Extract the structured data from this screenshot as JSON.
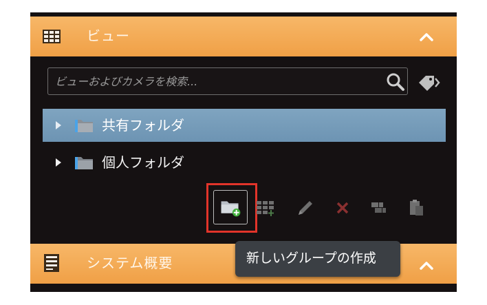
{
  "views": {
    "title": "ビュー",
    "search_placeholder": "ビューおよびカメラを検索...",
    "search_value": "",
    "tree": [
      {
        "label": "共有フォルダ",
        "selected": true
      },
      {
        "label": "個人フォルダ",
        "selected": false
      }
    ],
    "toolbar": [
      {
        "name": "new-group",
        "icon": "folder-plus-icon",
        "enabled": true
      },
      {
        "name": "new-view",
        "icon": "grid-plus-icon",
        "enabled": false
      },
      {
        "name": "rename",
        "icon": "pencil-icon",
        "enabled": false
      },
      {
        "name": "delete",
        "icon": "close-icon",
        "enabled": false
      },
      {
        "name": "copy",
        "icon": "copy-icon",
        "enabled": false
      },
      {
        "name": "paste",
        "icon": "paste-icon",
        "enabled": false
      }
    ]
  },
  "system": {
    "title": "システム概要"
  },
  "tooltip": {
    "text": "新しいグループの作成"
  },
  "colors": {
    "header_orange": "#f0a046",
    "panel_bg": "#151112",
    "selection_blue": "#7fa4c0",
    "highlight_red": "#e2342a",
    "tooltip_bg": "#3b3f44"
  }
}
